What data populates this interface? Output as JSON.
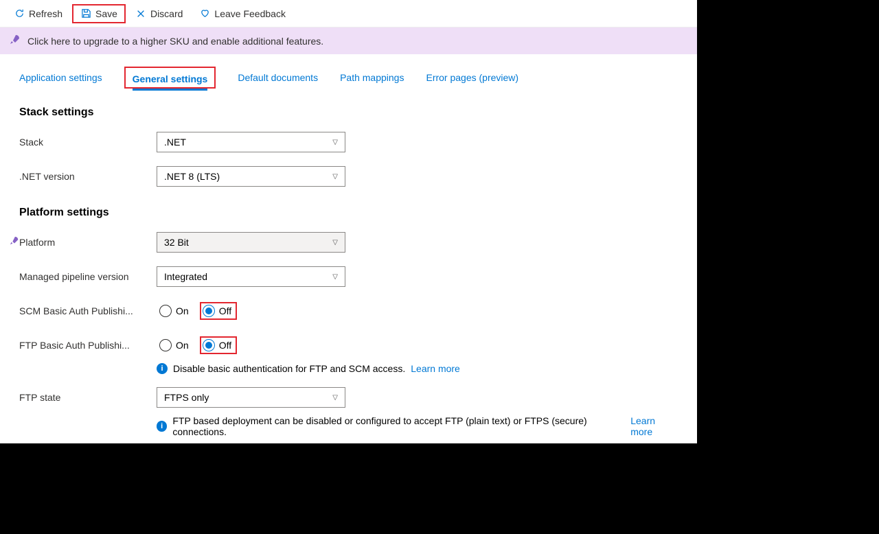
{
  "toolbar": {
    "refresh_label": "Refresh",
    "save_label": "Save",
    "discard_label": "Discard",
    "feedback_label": "Leave Feedback"
  },
  "banner": {
    "text": "Click here to upgrade to a higher SKU and enable additional features."
  },
  "tabs": {
    "app_settings": "Application settings",
    "general_settings": "General settings",
    "default_docs": "Default documents",
    "path_mappings": "Path mappings",
    "error_pages": "Error pages (preview)"
  },
  "sections": {
    "stack_title": "Stack settings",
    "platform_title": "Platform settings"
  },
  "fields": {
    "stack_label": "Stack",
    "stack_value": ".NET",
    "netver_label": ".NET version",
    "netver_value": ".NET 8 (LTS)",
    "platform_label": "Platform",
    "platform_value": "32 Bit",
    "pipeline_label": "Managed pipeline version",
    "pipeline_value": "Integrated",
    "scm_label": "SCM Basic Auth Publishi...",
    "ftp_label": "FTP Basic Auth Publishi...",
    "on_label": "On",
    "off_label": "Off",
    "ftpstate_label": "FTP state",
    "ftpstate_value": "FTPS only"
  },
  "helpers": {
    "basic_auth_text": "Disable basic authentication for FTP and SCM access.",
    "basic_auth_link": "Learn more",
    "ftp_text": "FTP based deployment can be disabled or configured to accept FTP (plain text) or FTPS (secure) connections.",
    "ftp_link": "Learn more"
  }
}
